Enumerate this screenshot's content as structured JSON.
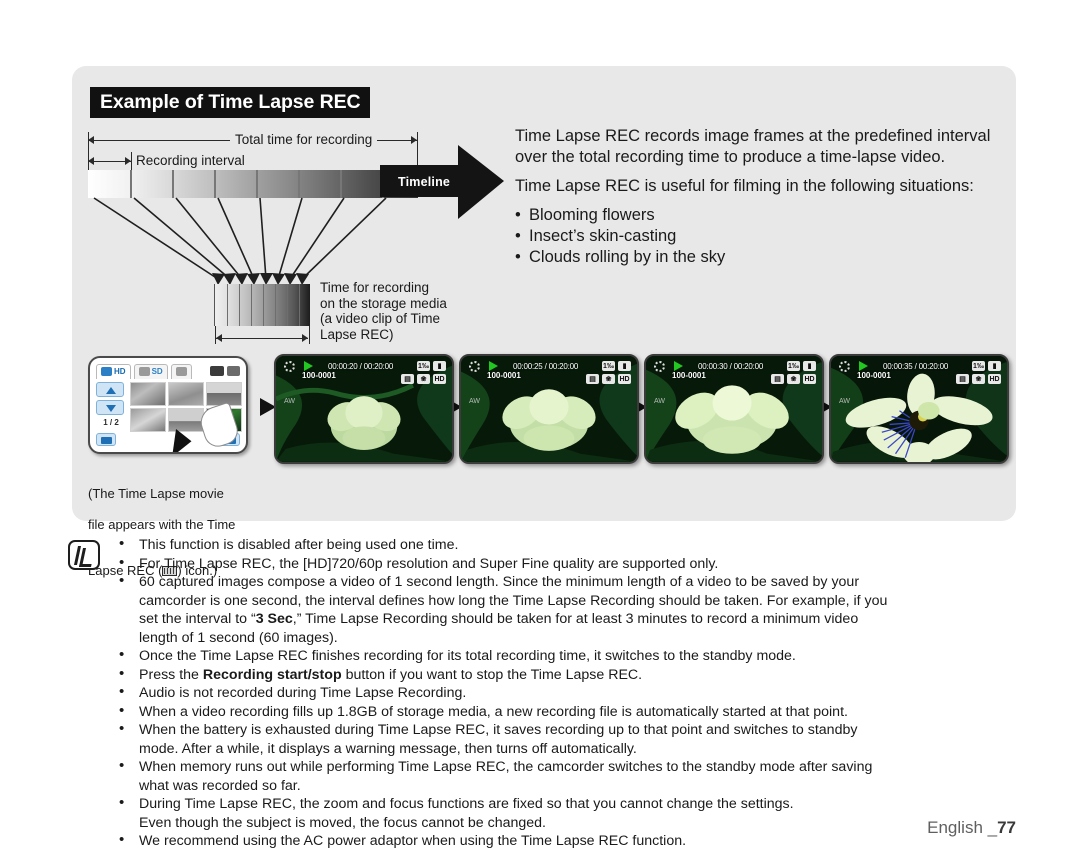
{
  "title_banner": "Example of Time Lapse REC",
  "diagram": {
    "total_time_label": "Total time for recording",
    "recording_interval_label": "Recording interval",
    "timeline_label": "Timeline",
    "storage_caption": "Time for recording\non the storage media\n(a video clip of Time\nLapse REC)"
  },
  "description": {
    "para1": "Time Lapse REC records image frames at the predefined interval over the total recording time to produce a time-lapse video.",
    "para2": "Time Lapse REC is useful for filming in the following situations:",
    "bullets": [
      "Blooming flowers",
      "Insect’s skin-casting",
      "Clouds rolling by in the sky"
    ]
  },
  "thumbnail_screen": {
    "tab_hd": "HD",
    "tab_sd": "SD",
    "tab_photo": "photo-tab-icon",
    "page_indicator": "1 / 2",
    "up_icon": "chevron-up-icon",
    "down_icon": "chevron-down-icon",
    "caption": "(The Time Lapse movie\nfile appears with the Time\nLapse REC (  ) icon.)",
    "caption_part1": "(The Time Lapse movie",
    "caption_part2": "file appears with the Time",
    "caption_part3a": "Lapse REC (",
    "caption_part3b": ") icon.)"
  },
  "video_screens": [
    {
      "elapsed": "00:00:20",
      "total": "00:20:00",
      "file": "100-0001",
      "quality": "HD",
      "sep": "▶"
    },
    {
      "elapsed": "00:00:25",
      "total": "00:20:00",
      "file": "100-0001",
      "quality": "HD",
      "sep": "▶"
    },
    {
      "elapsed": "00:00:30",
      "total": "00:20:00",
      "file": "100-0001",
      "quality": "HD",
      "sep": "▶"
    },
    {
      "elapsed": "00:00:35",
      "total": "00:20:00",
      "file": "100-0001",
      "quality": "HD",
      "sep": ""
    }
  ],
  "osd_labels": {
    "separator": "/",
    "mode_box": "1‰",
    "battery": "battery-icon",
    "fine_box": "▤",
    "res_box": "HD",
    "wb": "AW"
  },
  "notes": [
    {
      "text": "This function is disabled after being used one time.",
      "bullet": true
    },
    {
      "text": "For Time Lapse REC, the [HD]720/60p resolution and Super Fine quality are supported only.",
      "bullet": true
    },
    {
      "html": "60 captured images compose a video of 1 second length. Since the minimum length of a video to be saved by your",
      "bullet": true
    },
    {
      "text": "camcorder is one second, the interval defines how long the Time Lapse Recording should be taken. For example, if you",
      "bullet": false
    },
    {
      "html": "set the interval to “<b>3 Sec</b>,” Time Lapse Recording should be taken for at least 3 minutes to record a minimum video",
      "bullet": false
    },
    {
      "text": "length of 1 second (60 images).",
      "bullet": false
    },
    {
      "text": "Once the Time Lapse REC finishes recording for its total recording time, it switches to the standby mode.",
      "bullet": true
    },
    {
      "html": "Press the <b>Recording start/stop</b> button if you want to stop the Time Lapse REC.",
      "bullet": true
    },
    {
      "text": "Audio is not recorded during Time Lapse Recording.",
      "bullet": true
    },
    {
      "text": "When a video recording fills up 1.8GB of storage media, a new recording file is automatically started at that point.",
      "bullet": true
    },
    {
      "text": "When the battery is exhausted during Time Lapse REC, it saves recording up to that point and switches to standby",
      "bullet": true
    },
    {
      "text": "mode. After a while, it displays a warning message, then turns off automatically.",
      "bullet": false
    },
    {
      "text": "When memory runs out while performing Time Lapse REC, the camcorder switches to the standby mode after saving",
      "bullet": true
    },
    {
      "text": "what was recorded so far.",
      "bullet": false
    },
    {
      "text": "During Time Lapse REC, the zoom and focus functions are fixed so that you cannot change the settings.",
      "bullet": true
    },
    {
      "text": "Even though the subject is moved, the focus cannot be changed.",
      "bullet": false
    },
    {
      "text": "We recommend using the AC power adaptor when using the Time Lapse REC function.",
      "bullet": true
    }
  ],
  "footer": {
    "language": "English _",
    "page": "77"
  },
  "colors": {
    "panel_bg": "#e8e8e8",
    "banner_bg": "#111111",
    "accent_blue": "#2b7fc4",
    "play_green": "#22c722"
  }
}
